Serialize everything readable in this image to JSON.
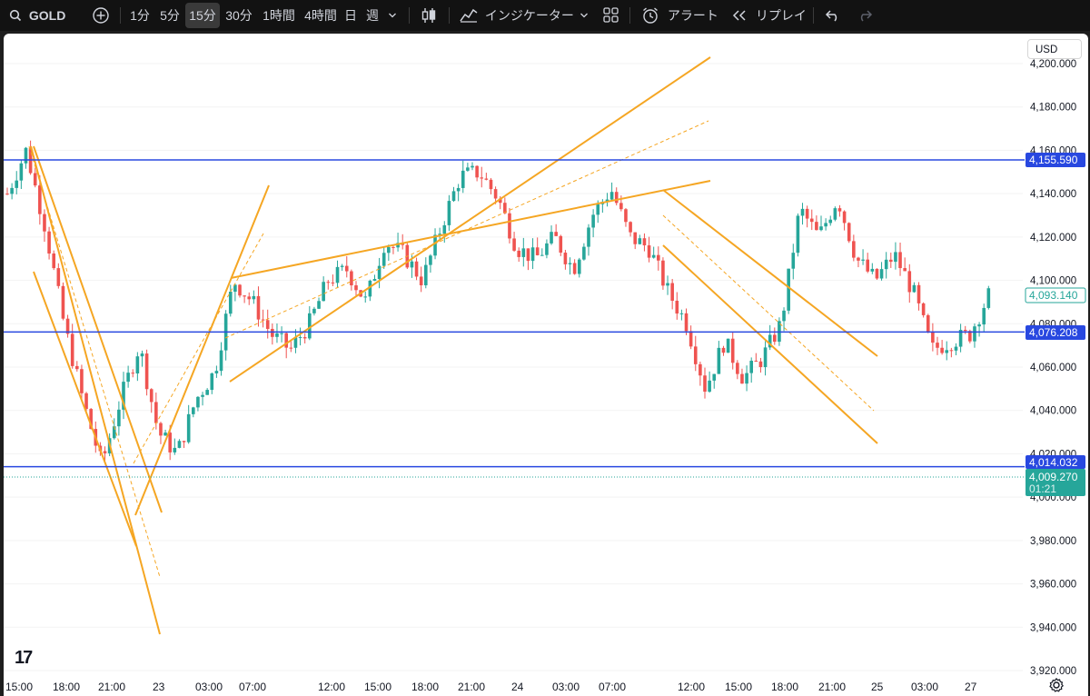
{
  "toolbar": {
    "symbol": "GOLD",
    "timeframes": [
      "1分",
      "5分",
      "15分",
      "30分",
      "1時間",
      "4時間",
      "日",
      "週"
    ],
    "active_timeframe": "15分",
    "indicators_label": "インジケーター",
    "alert_label": "アラート",
    "replay_label": "リプレイ"
  },
  "price_axis": {
    "currency": "USD",
    "tick_labels": [
      "4,200.000",
      "4,180.000",
      "4,160.000",
      "4,140.000",
      "4,120.000",
      "4,100.000",
      "4,080.000",
      "4,060.000",
      "4,040.000",
      "4,020.000",
      "4,000.000",
      "3,980.000",
      "3,960.000",
      "3,940.000",
      "3,920.000"
    ]
  },
  "time_axis": {
    "labels": [
      "15:00",
      "18:00",
      "21:00",
      "23",
      "03:00",
      "07:00",
      "12:00",
      "15:00",
      "18:00",
      "21:00",
      "24",
      "03:00",
      "07:00",
      "12:00",
      "15:00",
      "18:00",
      "21:00",
      "25",
      "03:00",
      "27"
    ]
  },
  "horizontal_lines": [
    {
      "label": "4,155.590",
      "value": 4155.59,
      "color": "#2848e0"
    },
    {
      "label": "4,076.208",
      "value": 4076.208,
      "color": "#2848e0"
    },
    {
      "label": "4,014.032",
      "value": 4014.032,
      "color": "#2848e0"
    }
  ],
  "price_badges": {
    "last_high": {
      "label": "4,093.140",
      "value": 4093.14,
      "color": "#26a69a"
    },
    "current": {
      "label": "4,009.270",
      "countdown": "01:21",
      "value": 4009.27,
      "color": "#26a69a"
    }
  },
  "colors": {
    "up": "#26a69a",
    "down": "#ef5350",
    "trendline": "#f5a623",
    "hline": "#2848e0"
  },
  "chart_data": {
    "type": "candlestick",
    "instrument": "GOLD",
    "timeframe": "15分",
    "ylim": [
      3915,
      4210
    ],
    "close_path": [
      4140,
      4160,
      4125,
      4080,
      4045,
      4015,
      4045,
      4070,
      4030,
      4020,
      4045,
      4058,
      4100,
      4090,
      4075,
      4068,
      4080,
      4100,
      4105,
      4090,
      4118,
      4112,
      4100,
      4125,
      4148,
      4150,
      4138,
      4115,
      4110,
      4120,
      4105,
      4130,
      4142,
      4120,
      4115,
      4095,
      4080,
      4050,
      4072,
      4055,
      4064,
      4080,
      4133,
      4120,
      4138,
      4110,
      4100,
      4112,
      4095,
      4068,
      4072,
      4075,
      4093
    ],
    "trendlines_note": "orange channel and trend lines drawn on chart"
  }
}
